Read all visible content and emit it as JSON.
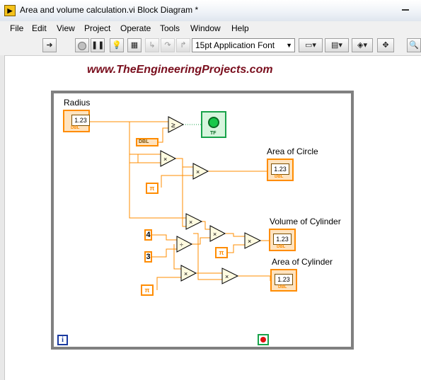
{
  "window": {
    "title": "Area and volume calculation.vi Block Diagram *",
    "app_icon": "labview-vi-icon"
  },
  "menu": {
    "items": [
      "File",
      "Edit",
      "View",
      "Project",
      "Operate",
      "Tools",
      "Window",
      "Help"
    ]
  },
  "toolbar": {
    "font_selector": "15pt Application Font",
    "buttons": [
      "run-arrow-icon",
      "abort-icon",
      "pause-icon",
      "highlight-execution-icon",
      "retain-wire-values-icon",
      "step-into-icon",
      "step-over-icon",
      "step-out-icon",
      "align-objects-icon",
      "distribute-objects-icon",
      "reorder-icon",
      "clean-up-diagram-icon",
      "search-icon"
    ]
  },
  "watermark": "www.TheEngineeringProjects.com",
  "diagram": {
    "controls": {
      "radius_label": "Radius",
      "radius_value": "1.23",
      "radius_type": "DBL"
    },
    "indicators": {
      "area_circle_label": "Area of Circle",
      "volume_cylinder_label": "Volume of Cylinder",
      "area_cylinder_label": "Area of Cylinder",
      "value": "1.23",
      "type": "DBL"
    },
    "boolean_indicator_tag": "TF",
    "constants": {
      "four": "4",
      "three": "3",
      "pi": "π",
      "dbl_const": "DBL"
    },
    "functions": {
      "multiply": "×",
      "divide": "÷",
      "compare": "≥"
    },
    "colors": {
      "numeric_wire": "#ff8c00",
      "boolean": "#18a34a",
      "frame": "#808080",
      "watermark": "#7a0f1e"
    }
  }
}
